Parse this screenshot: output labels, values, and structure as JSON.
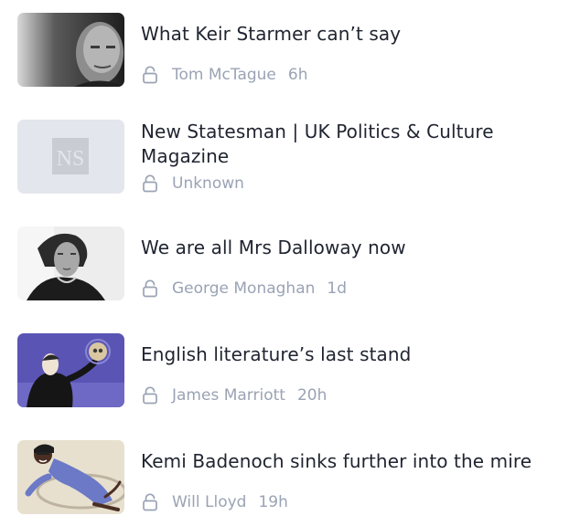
{
  "articles": [
    {
      "title": "What Keir Starmer can’t say",
      "author": "Tom McTague",
      "time": "6h",
      "icon": "unlock-icon"
    },
    {
      "title": "New Statesman | UK Politics & Culture Magazine",
      "author": "Unknown",
      "time": "",
      "icon": "unlock-icon",
      "logo_text": "NS"
    },
    {
      "title": "We are all Mrs Dalloway now",
      "author": "George Monaghan",
      "time": "1d",
      "icon": "unlock-icon"
    },
    {
      "title": "English literature’s last stand",
      "author": "James Marriott",
      "time": "20h",
      "icon": "unlock-icon"
    },
    {
      "title": "Kemi Badenoch sinks further into the mire",
      "author": "Will Lloyd",
      "time": "19h",
      "icon": "unlock-icon"
    }
  ],
  "colors": {
    "title_text": "#1f2430",
    "meta_text": "#9aa3b4",
    "placeholder_bg": "#e3e6ec"
  }
}
